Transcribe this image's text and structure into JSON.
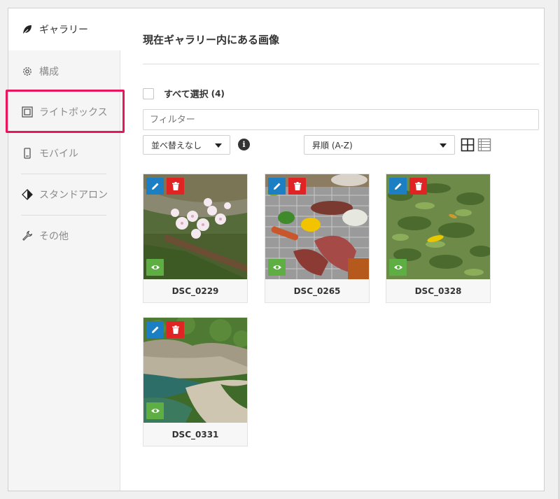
{
  "sidebar": {
    "items": [
      {
        "label": "ギャラリー",
        "icon": "leaf-icon"
      },
      {
        "label": "構成",
        "icon": "gear-icon"
      },
      {
        "label": "ライトボックス",
        "icon": "lightbox-icon"
      },
      {
        "label": "モバイル",
        "icon": "mobile-icon"
      },
      {
        "label": "スタンドアロン",
        "icon": "diamond-icon"
      },
      {
        "label": "その他",
        "icon": "wrench-icon"
      }
    ]
  },
  "main": {
    "title": "現在ギャラリー内にある画像",
    "select_all_label": "すべて選択",
    "select_all_count": "(4)",
    "filter_placeholder": "フィルター",
    "sort_select": "並べ替えなし",
    "order_select": "昇順 (A-Z)",
    "images": [
      {
        "caption": "DSC_0229"
      },
      {
        "caption": "DSC_0265"
      },
      {
        "caption": "DSC_0328"
      },
      {
        "caption": "DSC_0331"
      }
    ]
  },
  "colors": {
    "highlight": "#e8175d",
    "edit": "#1d7fc3",
    "delete": "#e02424",
    "view": "#5fae43"
  }
}
